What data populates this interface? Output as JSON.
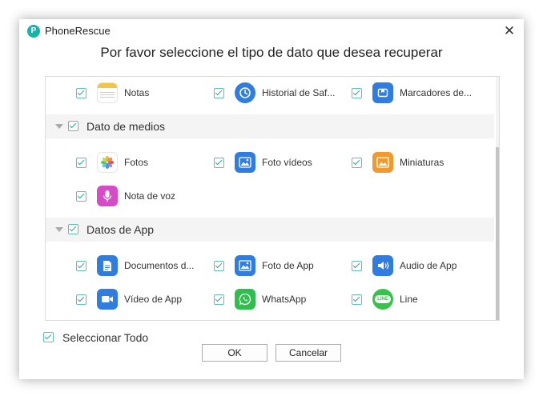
{
  "window": {
    "app_title": "PhoneRescue",
    "app_icon_letter": "P",
    "close_glyph": "✕"
  },
  "heading": "Por favor seleccione el tipo de dato que desea recuperar",
  "top_items": [
    {
      "label": "Notas",
      "icon": "notes-icon",
      "color": "#f4c543"
    },
    {
      "label": "Historial de Saf...",
      "icon": "safari-history-icon",
      "color": "#2f7de1"
    },
    {
      "label": "Marcadores de...",
      "icon": "bookmarks-icon",
      "color": "#2f7de1"
    }
  ],
  "sections": [
    {
      "label": "Dato de medios",
      "items": [
        {
          "label": "Fotos",
          "icon": "photos-icon"
        },
        {
          "label": "Foto vídeos",
          "icon": "photo-videos-icon",
          "color": "#2f7de1"
        },
        {
          "label": "Miniaturas",
          "icon": "thumbnails-icon",
          "color": "#f19a2b"
        },
        {
          "label": "Nota de voz",
          "icon": "voice-memo-icon",
          "color": "#d64bc7"
        }
      ]
    },
    {
      "label": "Datos de App",
      "items": [
        {
          "label": "Documentos d...",
          "icon": "documents-icon",
          "color": "#2f7de1"
        },
        {
          "label": "Foto de App",
          "icon": "app-photo-icon",
          "color": "#2f7de1"
        },
        {
          "label": "Audio de App",
          "icon": "app-audio-icon",
          "color": "#2f7de1"
        },
        {
          "label": "Vídeo de App",
          "icon": "app-video-icon",
          "color": "#2f7de1"
        },
        {
          "label": "WhatsApp",
          "icon": "whatsapp-icon",
          "color": "#2fbf4c"
        },
        {
          "label": "Line",
          "icon": "line-icon",
          "color": "#35c34a",
          "text": "LINE"
        }
      ]
    }
  ],
  "select_all_label": "Seleccionar Todo",
  "buttons": {
    "ok": "OK",
    "cancel": "Cancelar"
  }
}
